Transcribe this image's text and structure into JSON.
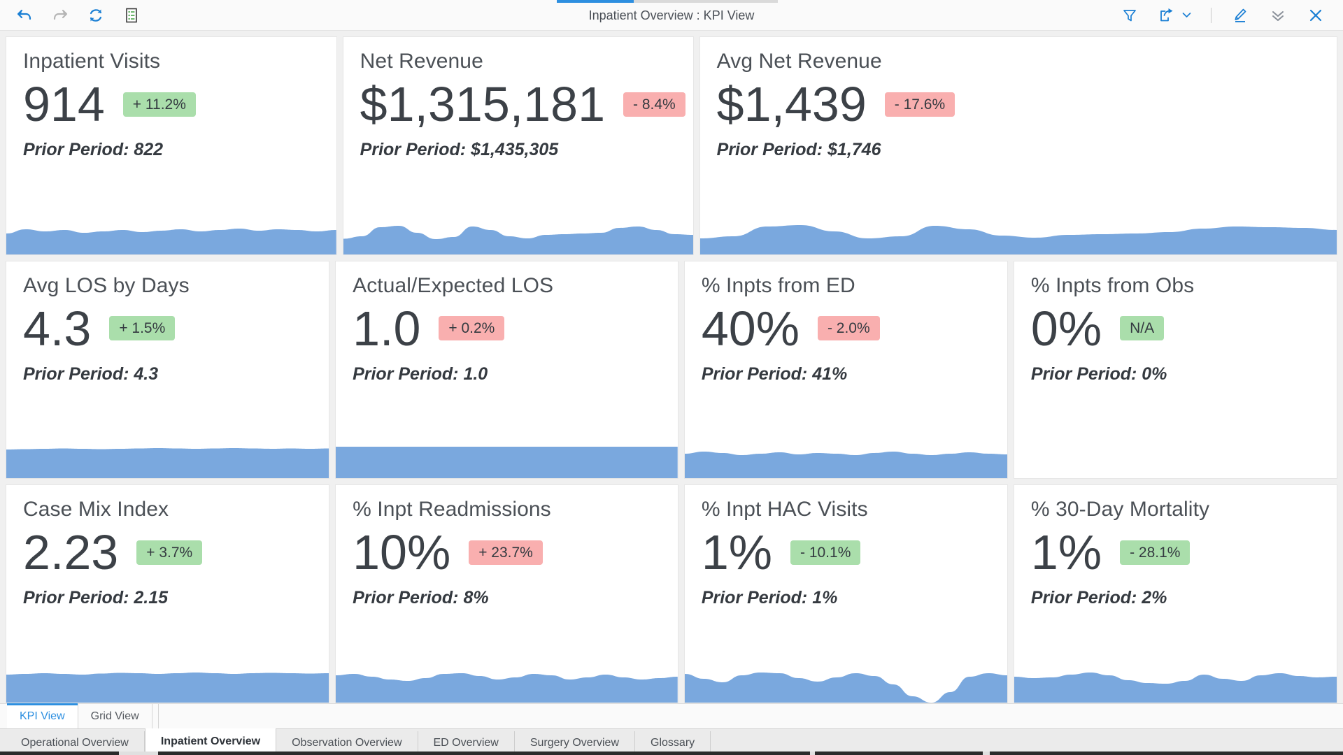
{
  "window": {
    "title": "Inpatient Overview : KPI View"
  },
  "toolbar": {
    "left_buttons": [
      {
        "name": "undo-icon",
        "label": "Undo",
        "state": "enabled"
      },
      {
        "name": "redo-icon",
        "label": "Redo",
        "state": "disabled"
      },
      {
        "name": "refresh-icon",
        "label": "Refresh",
        "state": "enabled"
      },
      {
        "name": "list-view-icon",
        "label": "Data",
        "state": "enabled"
      }
    ],
    "right_buttons": [
      {
        "name": "filter-icon",
        "label": "Filter"
      },
      {
        "name": "export-icon",
        "label": "Export"
      },
      {
        "name": "chevron-down-icon",
        "label": "Export options"
      },
      {
        "name": "edit-icon",
        "label": "Edit"
      },
      {
        "name": "collapse-icon",
        "label": "Collapse"
      },
      {
        "name": "close-icon",
        "label": "Close"
      }
    ]
  },
  "colors": {
    "accent": "#2d8fe0",
    "sparkline": "#7aa8de",
    "badge_positive_bg": "#aadeab",
    "badge_negative_bg": "#f9afaf",
    "card_bg": "#ffffff",
    "grid_bg": "#f0f0f0",
    "value_text": "#3c4147"
  },
  "prior_label": "Prior Period:",
  "kpi_rows": [
    [
      {
        "id": "inpatient-visits",
        "title": "Inpatient Visits",
        "value": "914",
        "badge": "+ 11.2%",
        "badge_tone": "up",
        "prior": "Prior Period: 822",
        "width_class": "w1",
        "sparkline": [
          0.6,
          0.72,
          0.66,
          0.7,
          0.62,
          0.66,
          0.7,
          0.64,
          0.68,
          0.72,
          0.66,
          0.7,
          0.74,
          0.68,
          0.72,
          0.7,
          0.66,
          0.7
        ]
      },
      {
        "id": "net-revenue",
        "title": "Net Revenue",
        "value": "$1,315,181",
        "badge": "- 8.4%",
        "badge_tone": "down",
        "prior": "Prior Period: $1,435,305",
        "width_class": "w2",
        "sparkline": [
          0.45,
          0.52,
          0.78,
          0.82,
          0.62,
          0.44,
          0.5,
          0.8,
          0.7,
          0.52,
          0.46,
          0.56,
          0.58,
          0.6,
          0.62,
          0.76,
          0.8,
          0.7,
          0.58,
          0.56
        ]
      },
      {
        "id": "avg-net-revenue",
        "title": "Avg Net Revenue",
        "value": "$1,439",
        "badge": "- 17.6%",
        "badge_tone": "down",
        "prior": "Prior Period: $1,746",
        "width_class": "w3",
        "sparkline": [
          0.46,
          0.52,
          0.8,
          0.84,
          0.66,
          0.46,
          0.52,
          0.82,
          0.72,
          0.54,
          0.48,
          0.56,
          0.58,
          0.6,
          0.64,
          0.74,
          0.8,
          0.78,
          0.76,
          0.7
        ]
      }
    ],
    [
      {
        "id": "avg-los-by-days",
        "title": "Avg LOS by Days",
        "value": "4.3",
        "badge": "+ 1.5%",
        "badge_tone": "up",
        "prior": "Prior Period: 4.3",
        "width_class": "w1",
        "sparkline": [
          0.82,
          0.83,
          0.84,
          0.85,
          0.84,
          0.83,
          0.84,
          0.85,
          0.86,
          0.85,
          0.84,
          0.85,
          0.86,
          0.85,
          0.84,
          0.85,
          0.84,
          0.85
        ]
      },
      {
        "id": "actual-expected-los",
        "title": "Actual/Expected LOS",
        "value": "1.0",
        "badge": "+ 0.2%",
        "badge_tone": "down",
        "prior": "Prior Period: 1.0",
        "width_class": "w2",
        "sparkline": [
          0.9,
          0.9,
          0.9,
          0.9,
          0.9,
          0.9,
          0.9,
          0.9,
          0.9,
          0.9,
          0.9,
          0.9,
          0.9,
          0.9,
          0.9,
          0.9,
          0.9,
          0.9
        ]
      },
      {
        "id": "pct-inpts-from-ed",
        "title": "% Inpts from ED",
        "value": "40%",
        "badge": "- 2.0%",
        "badge_tone": "down",
        "prior": "Prior Period: 41%",
        "width_class": "w1",
        "sparkline": [
          0.7,
          0.76,
          0.72,
          0.66,
          0.7,
          0.74,
          0.68,
          0.72,
          0.7,
          0.66,
          0.72,
          0.76,
          0.7,
          0.66,
          0.7,
          0.74,
          0.7,
          0.68
        ]
      },
      {
        "id": "pct-inpts-from-obs",
        "title": "% Inpts from Obs",
        "value": "0%",
        "badge": "N/A",
        "badge_tone": "na",
        "prior": "Prior Period: 0%",
        "width_class": "w1",
        "sparkline": []
      }
    ],
    [
      {
        "id": "case-mix-index",
        "title": "Case Mix Index",
        "value": "2.23",
        "badge": "+ 3.7%",
        "badge_tone": "up",
        "prior": "Prior Period: 2.15",
        "width_class": "w1",
        "sparkline": [
          0.8,
          0.82,
          0.84,
          0.82,
          0.8,
          0.83,
          0.85,
          0.84,
          0.82,
          0.84,
          0.86,
          0.84,
          0.82,
          0.84,
          0.85,
          0.84,
          0.83,
          0.84
        ]
      },
      {
        "id": "pct-inpt-readmissions",
        "title": "% Inpt Readmissions",
        "value": "10%",
        "badge": "+ 23.7%",
        "badge_tone": "down",
        "prior": "Prior Period: 8%",
        "width_class": "w2",
        "sparkline": [
          0.78,
          0.82,
          0.74,
          0.66,
          0.62,
          0.7,
          0.82,
          0.84,
          0.76,
          0.66,
          0.72,
          0.82,
          0.78,
          0.66,
          0.72,
          0.8,
          0.72,
          0.66,
          0.7,
          0.74
        ]
      },
      {
        "id": "pct-inpt-hac-visits",
        "title": "% Inpt HAC Visits",
        "value": "1%",
        "badge": "- 10.1%",
        "badge_tone": "up",
        "prior": "Prior Period: 1%",
        "width_class": "w1",
        "sparkline": [
          0.82,
          0.68,
          0.58,
          0.78,
          0.86,
          0.84,
          0.7,
          0.6,
          0.72,
          0.84,
          0.76,
          0.52,
          0.18,
          0.0,
          0.3,
          0.74,
          0.84,
          0.78
        ]
      },
      {
        "id": "pct-30-day-mortality",
        "title": "% 30-Day Mortality",
        "value": "1%",
        "badge": "- 28.1%",
        "badge_tone": "up",
        "prior": "Prior Period: 2%",
        "width_class": "w1",
        "sparkline": [
          0.74,
          0.7,
          0.72,
          0.8,
          0.86,
          0.78,
          0.64,
          0.56,
          0.54,
          0.62,
          0.8,
          0.68,
          0.62,
          0.78,
          0.84,
          0.76,
          0.72,
          0.74
        ]
      }
    ]
  ],
  "view_tabs": [
    {
      "label": "KPI View",
      "active": true
    },
    {
      "label": "Grid View",
      "active": false
    }
  ],
  "sheet_tabs": [
    {
      "label": "Operational Overview",
      "active": false
    },
    {
      "label": "Inpatient Overview",
      "active": true
    },
    {
      "label": "Observation Overview",
      "active": false
    },
    {
      "label": "ED Overview",
      "active": false
    },
    {
      "label": "Surgery Overview",
      "active": false
    },
    {
      "label": "Glossary",
      "active": false
    }
  ]
}
